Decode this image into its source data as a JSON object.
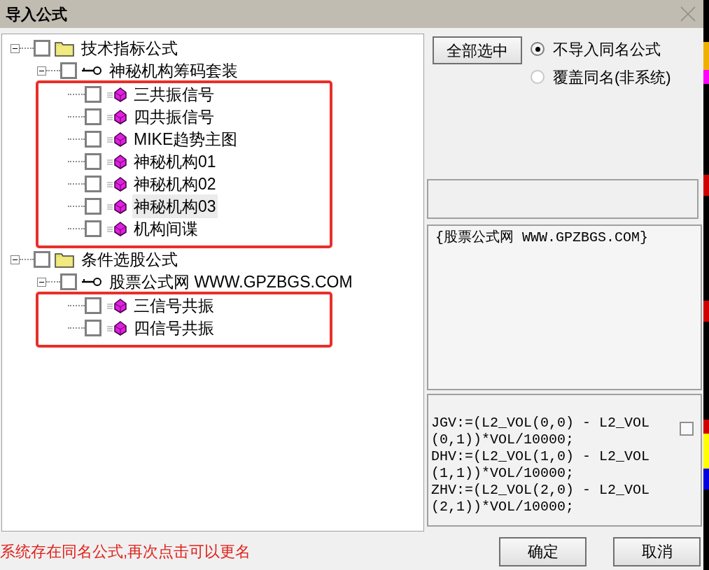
{
  "window": {
    "title": "导入公式"
  },
  "tree": [
    {
      "label": "技术指标公式",
      "kind": "folder",
      "checked": false,
      "expanded": true,
      "selected": false,
      "children": [
        {
          "label": "神秘机构筹码套装",
          "kind": "package",
          "checked": false,
          "expanded": true,
          "selected": false,
          "highlighted": true,
          "children": [
            {
              "label": "三共振信号",
              "kind": "formula",
              "checked": false,
              "selected": false
            },
            {
              "label": "四共振信号",
              "kind": "formula",
              "checked": false,
              "selected": false
            },
            {
              "label": "MIKE趋势主图",
              "kind": "formula",
              "checked": false,
              "selected": false
            },
            {
              "label": "神秘机构01",
              "kind": "formula",
              "checked": false,
              "selected": false
            },
            {
              "label": "神秘机构02",
              "kind": "formula",
              "checked": false,
              "selected": false
            },
            {
              "label": "神秘机构03",
              "kind": "formula",
              "checked": false,
              "selected": true
            },
            {
              "label": "机构间谍",
              "kind": "formula",
              "checked": false,
              "selected": false
            }
          ]
        }
      ]
    },
    {
      "label": "条件选股公式",
      "kind": "folder",
      "checked": false,
      "expanded": true,
      "selected": false,
      "children": [
        {
          "label": "股票公式网 WWW.GPZBGS.COM",
          "kind": "package",
          "checked": false,
          "expanded": true,
          "selected": false,
          "highlighted": true,
          "children": [
            {
              "label": "三信号共振",
              "kind": "formula",
              "checked": false,
              "selected": false
            },
            {
              "label": "四信号共振",
              "kind": "formula",
              "checked": false,
              "selected": false
            }
          ]
        }
      ]
    }
  ],
  "select_all_button": "全部选中",
  "options": [
    {
      "label": "不导入同名公式",
      "selected": true
    },
    {
      "label": "覆盖同名(非系统)",
      "selected": false
    }
  ],
  "description": "{股票公式网 WWW.GPZBGS.COM}",
  "code": {
    "lines": [
      "JGV:=(L2_VOL(0,0) - L2_VOL",
      "(0,1))*VOL/10000;",
      "DHV:=(L2_VOL(1,0) - L2_VOL",
      "(1,1))*VOL/10000;",
      "ZHV:=(L2_VOL(2,0) - L2_VOL",
      "(2,1))*VOL/10000;"
    ],
    "checked": false
  },
  "status_message": "系统存在同名公式,再次点击可以更名",
  "buttons": [
    "确定",
    "取消"
  ]
}
